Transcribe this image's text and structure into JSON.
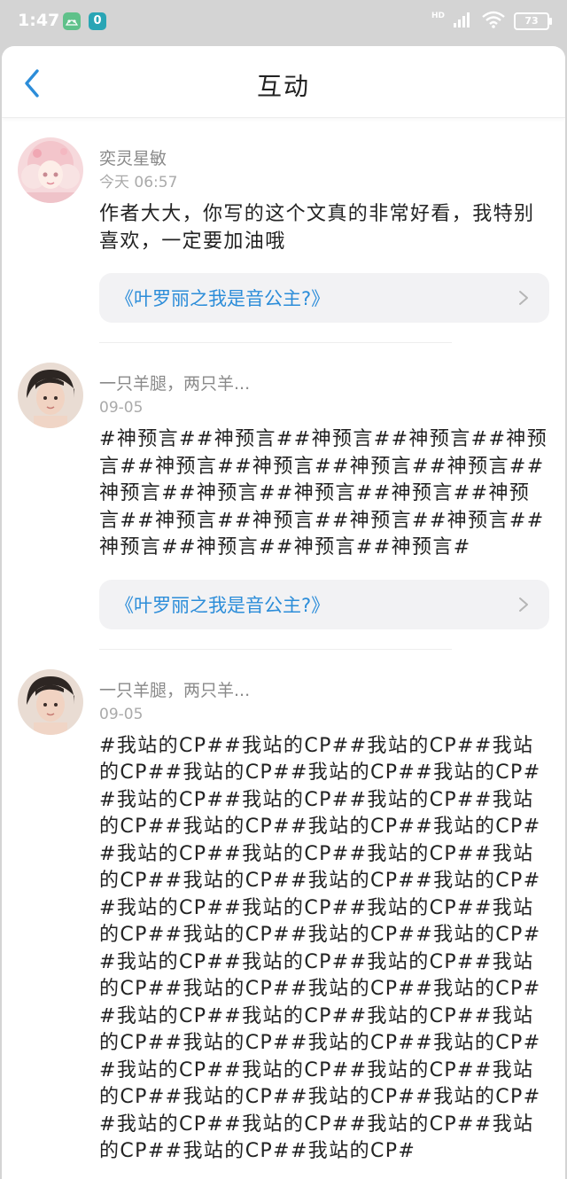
{
  "status_bar": {
    "time": "1:47",
    "app_badge_1": "",
    "app_badge_2": "0",
    "signal_label": "HD",
    "battery": "73"
  },
  "header": {
    "title": "互动"
  },
  "comments": [
    {
      "username": "奕灵星敏",
      "time": "今天 06:57",
      "text": "作者大大，你写的这个文真的非常好看，我特别喜欢，一定要加油哦",
      "book": "《叶罗丽之我是音公主?》"
    },
    {
      "username": "一只羊腿，两只羊...",
      "time": "09-05",
      "text": "#神预言##神预言##神预言##神预言##神预言##神预言##神预言##神预言##神预言##神预言##神预言##神预言##神预言##神预言##神预言##神预言##神预言##神预言##神预言##神预言##神预言##神预言#",
      "book": "《叶罗丽之我是音公主?》"
    },
    {
      "username": "一只羊腿，两只羊...",
      "time": "09-05",
      "text": "#我站的CP##我站的CP##我站的CP##我站的CP##我站的CP##我站的CP##我站的CP##我站的CP##我站的CP##我站的CP##我站的CP##我站的CP##我站的CP##我站的CP##我站的CP##我站的CP##我站的CP##我站的CP##我站的CP##我站的CP##我站的CP##我站的CP##我站的CP##我站的CP##我站的CP##我站的CP##我站的CP##我站的CP##我站的CP##我站的CP##我站的CP##我站的CP##我站的CP##我站的CP##我站的CP##我站的CP##我站的CP##我站的CP##我站的CP##我站的CP##我站的CP##我站的CP##我站的CP##我站的CP##我站的CP##我站的CP##我站的CP##我站的CP##我站的CP##我站的CP##我站的CP##我站的CP##我站的CP##我站的CP##我站的CP#"
    }
  ],
  "colors": {
    "accent": "#2c8dd9",
    "status_bar_bg": "#d4d4d4"
  }
}
